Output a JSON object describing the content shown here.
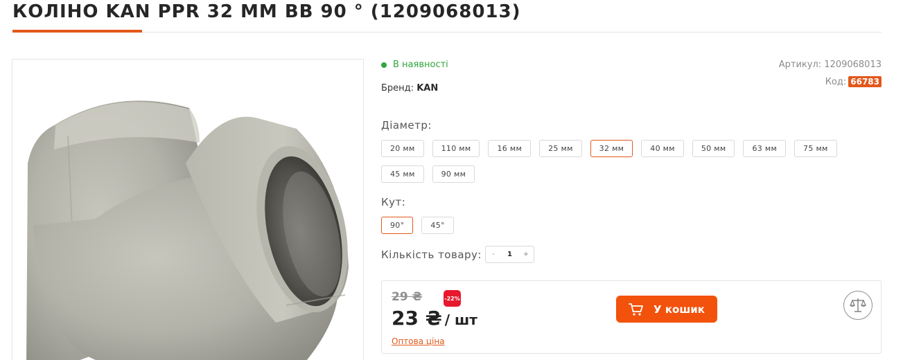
{
  "product": {
    "title": "КОЛІНО KAN PPR 32 ММ ВВ 90 ° (1209068013)",
    "image_alt": "grey PPR elbow fitting 90°"
  },
  "info": {
    "stock_status": "В наявності",
    "article_label": "Артикул:",
    "article_value": "1209068013",
    "brand_label": "Бренд:",
    "brand_value": "KAN",
    "code_label": "Код:",
    "code_value": "66783"
  },
  "diameter": {
    "label": "Діаметр:",
    "options": [
      "20 мм",
      "110 мм",
      "16 мм",
      "25 мм",
      "32 мм",
      "40 мм",
      "50 мм",
      "63 мм",
      "75 мм",
      "45 мм",
      "90 мм"
    ],
    "selected": "32 мм"
  },
  "angle": {
    "label": "Кут:",
    "options": [
      "90°",
      "45°"
    ],
    "selected": "90°"
  },
  "quantity": {
    "label": "Кількість товару:",
    "minus": "-",
    "value": "1",
    "plus": "+"
  },
  "pricing": {
    "old_price": "29 ₴",
    "discount": "-22%",
    "price": "23 ₴",
    "unit": "/ шт",
    "wholesale_link": "Оптова ціна",
    "cart_button": "У кошик"
  },
  "colors": {
    "accent": "#e2581b",
    "cart_button": "#f2520c",
    "in_stock": "#2fa63b",
    "discount_badge": "#e7192d"
  },
  "icons": [
    "cart-icon",
    "compare-scales-icon"
  ]
}
